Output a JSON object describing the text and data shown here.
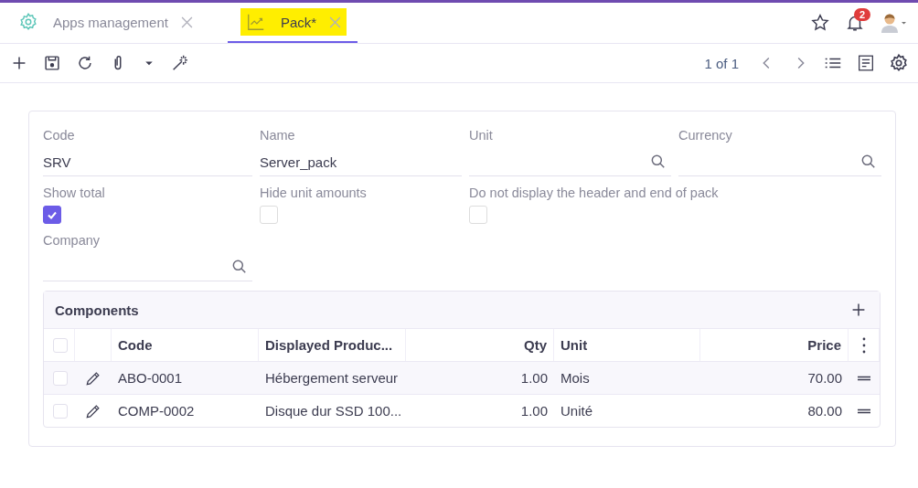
{
  "tabs": [
    {
      "kind": "settings",
      "label": "Apps management",
      "selected": false,
      "highlighted": false
    },
    {
      "kind": "chart",
      "label": "Pack*",
      "selected": true,
      "highlighted": true
    }
  ],
  "notifications": {
    "count": "2"
  },
  "pager": "1 of 1",
  "fields": [
    {
      "kind": "text",
      "label": "Code",
      "value": "SRV"
    },
    {
      "kind": "text",
      "label": "Name",
      "value": "Server_pack"
    },
    {
      "kind": "lookup",
      "label": "Unit"
    },
    {
      "kind": "lookup",
      "label": "Currency"
    }
  ],
  "checkboxes": [
    {
      "label": "Show total",
      "checked": true
    },
    {
      "label": "Hide unit amounts",
      "checked": false
    },
    {
      "label": "Do not display the header and end of pack",
      "checked": false
    }
  ],
  "company": {
    "kind": "lookup",
    "label": "Company"
  },
  "components": {
    "title": "Components",
    "all_checked": false,
    "columns": [
      "Code",
      "Displayed Produc...",
      "Qty",
      "Unit",
      "Price"
    ],
    "rows": [
      {
        "checked": false,
        "code": "ABO-0001",
        "product": "Hébergement serveur",
        "qty": "1.00",
        "unit": "Mois",
        "price": "70.00"
      },
      {
        "checked": false,
        "code": "COMP-0002",
        "product": "Disque dur SSD 100...",
        "qty": "1.00",
        "unit": "Unité",
        "price": "80.00"
      }
    ]
  }
}
